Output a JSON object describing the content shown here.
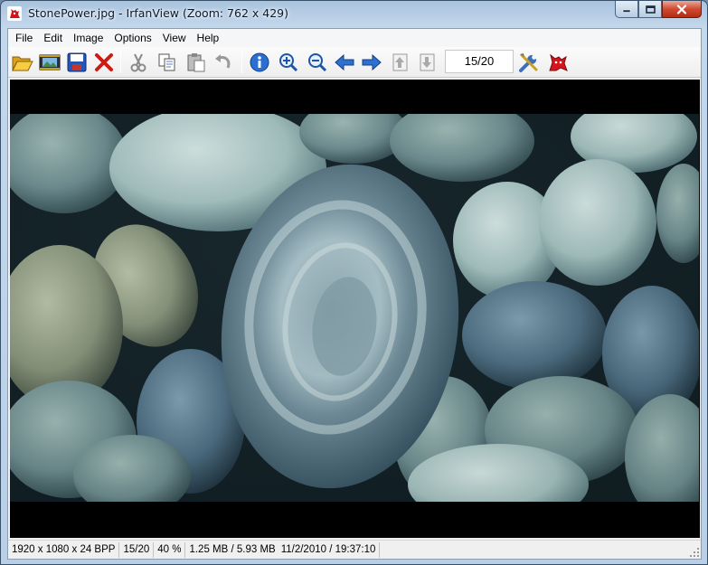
{
  "window": {
    "title": "StonePower.jpg - IrfanView (Zoom: 762 x 429)",
    "app_icon": "irfanview-cat-icon",
    "buttons": [
      "minimize-icon",
      "maximize-icon",
      "close-icon"
    ]
  },
  "menu": {
    "items": [
      {
        "label": "File"
      },
      {
        "label": "Edit"
      },
      {
        "label": "Image"
      },
      {
        "label": "Options"
      },
      {
        "label": "View"
      },
      {
        "label": "Help"
      }
    ]
  },
  "toolbar": {
    "buttons": [
      {
        "icon": "open-folder-icon"
      },
      {
        "icon": "slideshow-icon"
      },
      {
        "icon": "save-icon"
      },
      {
        "icon": "delete-icon"
      },
      {
        "icon": "cut-icon"
      },
      {
        "icon": "copy-icon"
      },
      {
        "icon": "paste-icon"
      },
      {
        "icon": "undo-icon"
      },
      {
        "icon": "info-icon"
      },
      {
        "icon": "zoom-in-icon"
      },
      {
        "icon": "zoom-out-icon"
      },
      {
        "icon": "previous-icon"
      },
      {
        "icon": "next-icon"
      },
      {
        "icon": "first-page-icon"
      },
      {
        "icon": "last-page-icon"
      },
      {
        "icon": "properties-icon"
      },
      {
        "icon": "irfanview-cat-icon"
      }
    ],
    "page_counter": "15/20"
  },
  "image": {
    "name": "StonePower.jpg",
    "colors": {
      "background": "#000000",
      "stone_light": "#a7c3cc",
      "stone_dark": "#3a5560"
    }
  },
  "statusbar": {
    "dimensions": "1920 x 1080 x 24 BPP",
    "index": "15/20",
    "zoom": "40 %",
    "size": "1.25 MB / 5.93 MB",
    "datetime": "11/2/2010 / 19:37:10"
  }
}
